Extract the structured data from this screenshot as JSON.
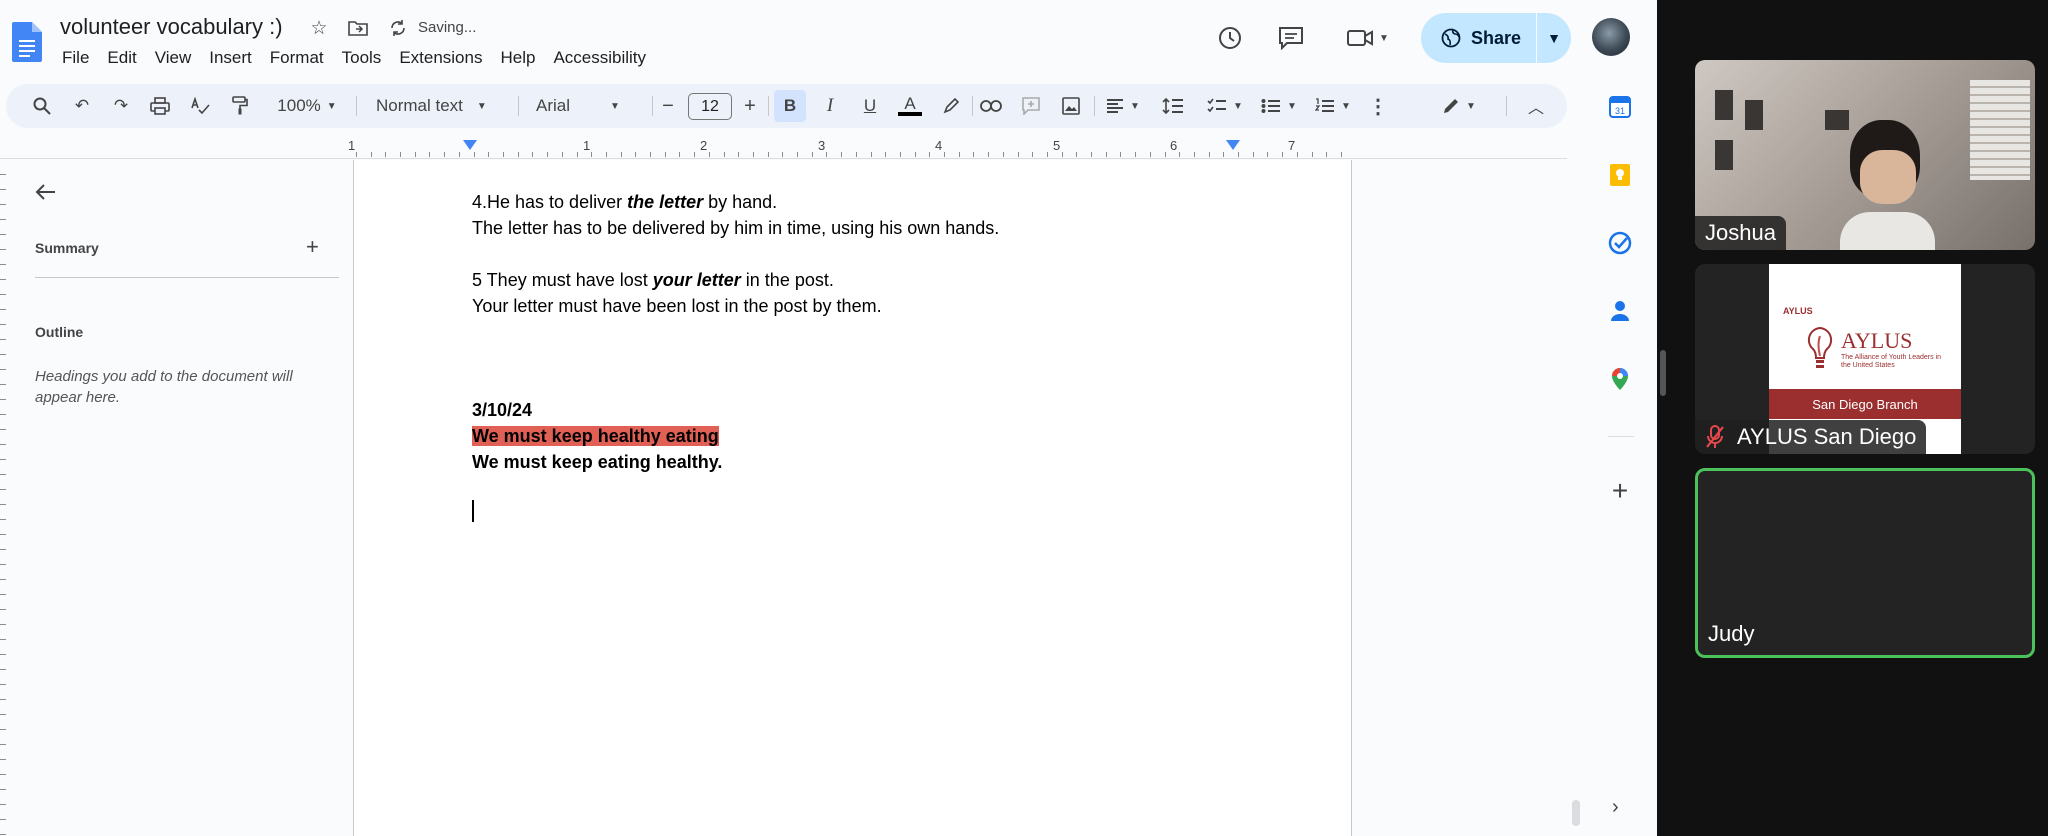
{
  "doc": {
    "title": "volunteer vocabulary :)",
    "saving_status": "Saving...",
    "menu": [
      "File",
      "Edit",
      "View",
      "Insert",
      "Format",
      "Tools",
      "Extensions",
      "Help",
      "Accessibility"
    ],
    "share_label": "Share"
  },
  "toolbar": {
    "zoom": "100%",
    "style": "Normal text",
    "font": "Arial",
    "font_size": "12",
    "bold": "B",
    "italic": "I",
    "underline": "U",
    "text_color": "A"
  },
  "ruler": {
    "numbers": [
      "1",
      "1",
      "2",
      "3",
      "4",
      "5",
      "6",
      "7"
    ]
  },
  "outline": {
    "summary_label": "Summary",
    "outline_label": "Outline",
    "hint": "Headings you add to the document will appear here."
  },
  "document": {
    "line1_prefix": "4.He has to deliver ",
    "line1_emph": "the letter",
    "line1_suffix": " by hand.",
    "line2": "The letter has to be delivered by him in time, using his own hands.",
    "line3_prefix": "5 They must have lost ",
    "line3_emph": "your letter",
    "line3_suffix": " in the post.",
    "line4": "Your letter must have been lost in the post by them.",
    "date": "3/10/24",
    "wrong_sentence": "We must keep healthy eating",
    "correct_sentence": "We must keep eating healthy."
  },
  "zoom_call": {
    "participants": [
      {
        "name": "Joshua"
      },
      {
        "name": "AYLUS San Diego"
      },
      {
        "name": "Judy"
      }
    ],
    "aylus_card": {
      "logo_text": "AYLUS",
      "subtitle": "The Alliance of Youth Leaders in the United States",
      "branch": "San Diego Branch"
    }
  },
  "colors": {
    "highlight": "#e06055",
    "share_bg": "#c2e7ff",
    "active_speaker_border": "#4cc25a"
  }
}
